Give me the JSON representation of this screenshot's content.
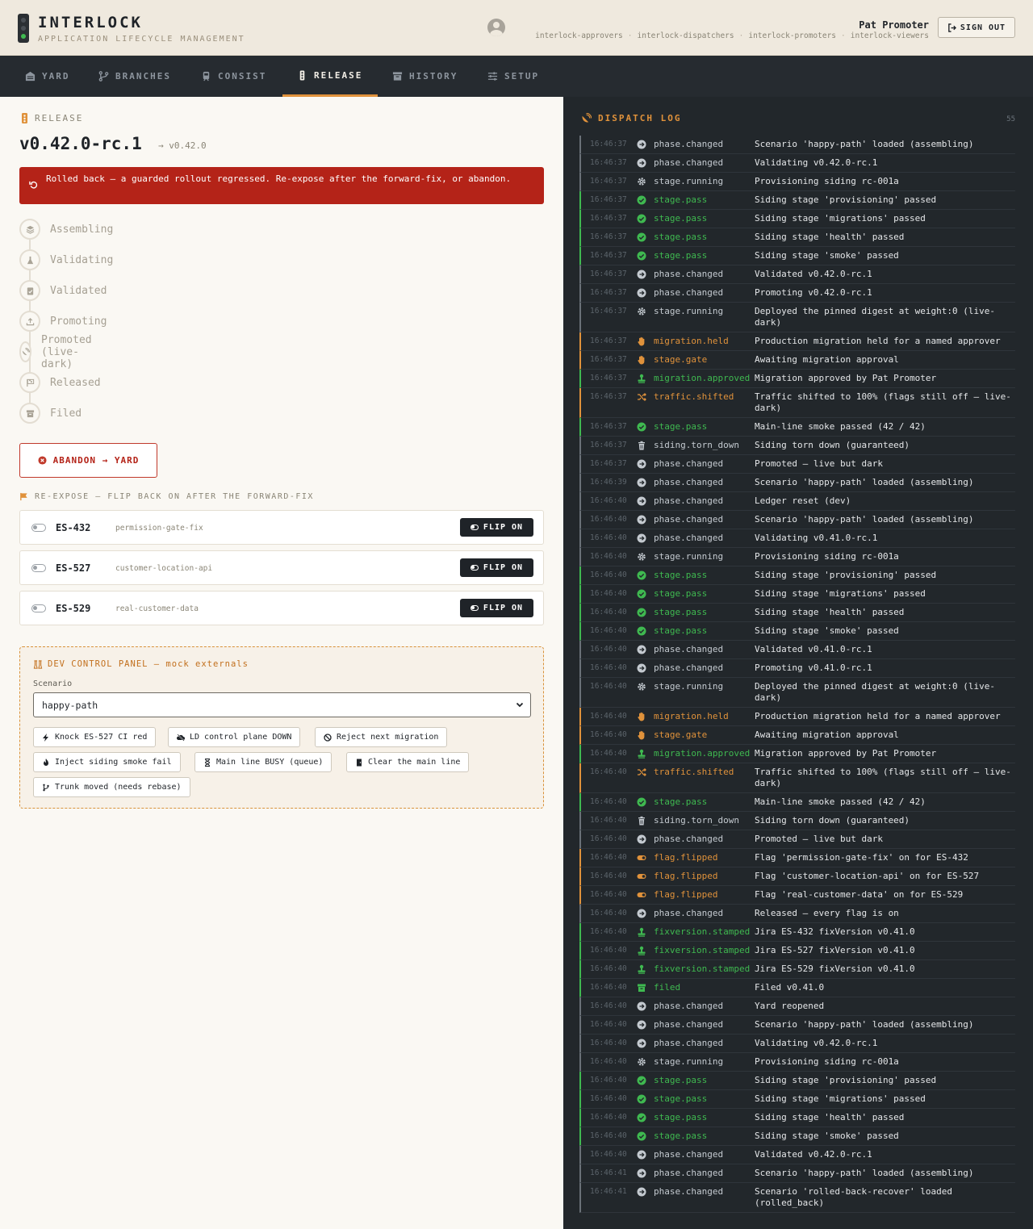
{
  "header": {
    "brand": "INTERLOCK",
    "tagline": "APPLICATION LIFECYCLE MANAGEMENT",
    "user_name": "Pat Promoter",
    "groups": [
      "interlock-approvers",
      "interlock-dispatchers",
      "interlock-promoters",
      "interlock-viewers"
    ],
    "sign_out": "SIGN OUT"
  },
  "nav": {
    "tabs": [
      {
        "label": "YARD",
        "icon": "warehouse-icon"
      },
      {
        "label": "BRANCHES",
        "icon": "branch-icon"
      },
      {
        "label": "CONSIST",
        "icon": "train-icon"
      },
      {
        "label": "RELEASE",
        "icon": "traffic-light-icon",
        "active": true
      },
      {
        "label": "HISTORY",
        "icon": "archive-icon"
      },
      {
        "label": "SETUP",
        "icon": "sliders-icon"
      }
    ]
  },
  "release": {
    "section_label": "RELEASE",
    "version": "v0.42.0-rc.1",
    "target_version": "→ v0.42.0",
    "alert": "Rolled back — a guarded rollout regressed. Re-expose after the forward-fix, or abandon.",
    "steps": [
      {
        "label": "Assembling",
        "icon": "layers-icon"
      },
      {
        "label": "Validating",
        "icon": "flask-icon"
      },
      {
        "label": "Validated",
        "icon": "clipboard-check-icon"
      },
      {
        "label": "Promoting",
        "icon": "upload-icon"
      },
      {
        "label": "Promoted (live-dark)",
        "icon": "satellite-dish-icon"
      },
      {
        "label": "Released",
        "icon": "flag-checkered-icon"
      },
      {
        "label": "Filed",
        "icon": "archive-icon"
      }
    ],
    "abandon_label": "ABANDON → YARD",
    "reexpose_label": "RE-EXPOSE — FLIP BACK ON AFTER THE FORWARD-FIX",
    "flags": [
      {
        "key": "ES-432",
        "name": "permission-gate-fix",
        "button": "FLIP ON"
      },
      {
        "key": "ES-527",
        "name": "customer-location-api",
        "button": "FLIP ON"
      },
      {
        "key": "ES-529",
        "name": "real-customer-data",
        "button": "FLIP ON"
      }
    ]
  },
  "dev_panel": {
    "title": "DEV CONTROL PANEL — mock externals",
    "scenario_label": "Scenario",
    "scenario_value": "happy-path",
    "buttons": [
      {
        "label": "Knock ES-527 CI red",
        "icon": "bolt-icon"
      },
      {
        "label": "LD control plane DOWN",
        "icon": "cloud-off-icon"
      },
      {
        "label": "Reject next migration",
        "icon": "ban-icon"
      },
      {
        "label": "Inject siding smoke fail",
        "icon": "fire-icon"
      },
      {
        "label": "Main line BUSY (queue)",
        "icon": "hourglass-icon"
      },
      {
        "label": "Clear the main line",
        "icon": "door-icon"
      },
      {
        "label": "Trunk moved (needs rebase)",
        "icon": "branch-icon"
      }
    ]
  },
  "dispatch_log": {
    "title": "DISPATCH LOG",
    "count": "55",
    "colors": {
      "pass": "#3fb950",
      "warn": "#e0923b",
      "neutral": "#c4cad0"
    },
    "entries": [
      {
        "t": "16:46:37",
        "icon": "arrow-circle",
        "kind": "neutral",
        "event": "phase.changed",
        "msg": "Scenario 'happy-path' loaded (assembling)"
      },
      {
        "t": "16:46:37",
        "icon": "arrow-circle",
        "kind": "neutral",
        "event": "phase.changed",
        "msg": "Validating v0.42.0-rc.1"
      },
      {
        "t": "16:46:37",
        "icon": "gear",
        "kind": "neutral",
        "event": "stage.running",
        "msg": "Provisioning siding rc-001a"
      },
      {
        "t": "16:46:37",
        "icon": "check-circle",
        "kind": "green",
        "event": "stage.pass",
        "msg": "Siding stage 'provisioning' passed"
      },
      {
        "t": "16:46:37",
        "icon": "check-circle",
        "kind": "green",
        "event": "stage.pass",
        "msg": "Siding stage 'migrations' passed"
      },
      {
        "t": "16:46:37",
        "icon": "check-circle",
        "kind": "green",
        "event": "stage.pass",
        "msg": "Siding stage 'health' passed"
      },
      {
        "t": "16:46:37",
        "icon": "check-circle",
        "kind": "green",
        "event": "stage.pass",
        "msg": "Siding stage 'smoke' passed"
      },
      {
        "t": "16:46:37",
        "icon": "arrow-circle",
        "kind": "neutral",
        "event": "phase.changed",
        "msg": "Validated v0.42.0-rc.1"
      },
      {
        "t": "16:46:37",
        "icon": "arrow-circle",
        "kind": "neutral",
        "event": "phase.changed",
        "msg": "Promoting v0.42.0-rc.1"
      },
      {
        "t": "16:46:37",
        "icon": "gear",
        "kind": "neutral",
        "event": "stage.running",
        "msg": "Deployed the pinned digest at weight:0 (live-dark)",
        "tall": true
      },
      {
        "t": "16:46:37",
        "icon": "hand",
        "kind": "amber",
        "event": "migration.held",
        "msg": "Production migration held for a named approver"
      },
      {
        "t": "16:46:37",
        "icon": "hand",
        "kind": "amber",
        "event": "stage.gate",
        "msg": "Awaiting migration approval"
      },
      {
        "t": "16:46:37",
        "icon": "stamp",
        "kind": "green",
        "event": "migration.approved",
        "msg": "Migration approved by Pat Promoter"
      },
      {
        "t": "16:46:37",
        "icon": "shuffle",
        "kind": "amber",
        "event": "traffic.shifted",
        "msg": "Traffic shifted to 100% (flags still off — live-dark)",
        "tall": true
      },
      {
        "t": "16:46:37",
        "icon": "check-circle",
        "kind": "green",
        "event": "stage.pass",
        "msg": "Main-line smoke passed (42 / 42)"
      },
      {
        "t": "16:46:37",
        "icon": "trash",
        "kind": "neutral",
        "event": "siding.torn_down",
        "msg": "Siding torn down (guaranteed)"
      },
      {
        "t": "16:46:37",
        "icon": "arrow-circle",
        "kind": "neutral",
        "event": "phase.changed",
        "msg": "Promoted — live but dark"
      },
      {
        "t": "16:46:39",
        "icon": "arrow-circle",
        "kind": "neutral",
        "event": "phase.changed",
        "msg": "Scenario 'happy-path' loaded (assembling)"
      },
      {
        "t": "16:46:40",
        "icon": "arrow-circle",
        "kind": "neutral",
        "event": "phase.changed",
        "msg": "Ledger reset (dev)"
      },
      {
        "t": "16:46:40",
        "icon": "arrow-circle",
        "kind": "neutral",
        "event": "phase.changed",
        "msg": "Scenario 'happy-path' loaded (assembling)"
      },
      {
        "t": "16:46:40",
        "icon": "arrow-circle",
        "kind": "neutral",
        "event": "phase.changed",
        "msg": "Validating v0.41.0-rc.1"
      },
      {
        "t": "16:46:40",
        "icon": "gear",
        "kind": "neutral",
        "event": "stage.running",
        "msg": "Provisioning siding rc-001a"
      },
      {
        "t": "16:46:40",
        "icon": "check-circle",
        "kind": "green",
        "event": "stage.pass",
        "msg": "Siding stage 'provisioning' passed"
      },
      {
        "t": "16:46:40",
        "icon": "check-circle",
        "kind": "green",
        "event": "stage.pass",
        "msg": "Siding stage 'migrations' passed"
      },
      {
        "t": "16:46:40",
        "icon": "check-circle",
        "kind": "green",
        "event": "stage.pass",
        "msg": "Siding stage 'health' passed"
      },
      {
        "t": "16:46:40",
        "icon": "check-circle",
        "kind": "green",
        "event": "stage.pass",
        "msg": "Siding stage 'smoke' passed"
      },
      {
        "t": "16:46:40",
        "icon": "arrow-circle",
        "kind": "neutral",
        "event": "phase.changed",
        "msg": "Validated v0.41.0-rc.1"
      },
      {
        "t": "16:46:40",
        "icon": "arrow-circle",
        "kind": "neutral",
        "event": "phase.changed",
        "msg": "Promoting v0.41.0-rc.1"
      },
      {
        "t": "16:46:40",
        "icon": "gear",
        "kind": "neutral",
        "event": "stage.running",
        "msg": "Deployed the pinned digest at weight:0 (live-dark)",
        "tall": true
      },
      {
        "t": "16:46:40",
        "icon": "hand",
        "kind": "amber",
        "event": "migration.held",
        "msg": "Production migration held for a named approver"
      },
      {
        "t": "16:46:40",
        "icon": "hand",
        "kind": "amber",
        "event": "stage.gate",
        "msg": "Awaiting migration approval"
      },
      {
        "t": "16:46:40",
        "icon": "stamp",
        "kind": "green",
        "event": "migration.approved",
        "msg": "Migration approved by Pat Promoter"
      },
      {
        "t": "16:46:40",
        "icon": "shuffle",
        "kind": "amber",
        "event": "traffic.shifted",
        "msg": "Traffic shifted to 100% (flags still off — live-dark)",
        "tall": true
      },
      {
        "t": "16:46:40",
        "icon": "check-circle",
        "kind": "green",
        "event": "stage.pass",
        "msg": "Main-line smoke passed (42 / 42)"
      },
      {
        "t": "16:46:40",
        "icon": "trash",
        "kind": "neutral",
        "event": "siding.torn_down",
        "msg": "Siding torn down (guaranteed)"
      },
      {
        "t": "16:46:40",
        "icon": "arrow-circle",
        "kind": "neutral",
        "event": "phase.changed",
        "msg": "Promoted — live but dark"
      },
      {
        "t": "16:46:40",
        "icon": "toggle",
        "kind": "amber",
        "event": "flag.flipped",
        "msg": "Flag 'permission-gate-fix' on for ES-432"
      },
      {
        "t": "16:46:40",
        "icon": "toggle",
        "kind": "amber",
        "event": "flag.flipped",
        "msg": "Flag 'customer-location-api' on for ES-527"
      },
      {
        "t": "16:46:40",
        "icon": "toggle",
        "kind": "amber",
        "event": "flag.flipped",
        "msg": "Flag 'real-customer-data' on for ES-529"
      },
      {
        "t": "16:46:40",
        "icon": "arrow-circle",
        "kind": "neutral",
        "event": "phase.changed",
        "msg": "Released — every flag is on"
      },
      {
        "t": "16:46:40",
        "icon": "stamp",
        "kind": "green",
        "event": "fixversion.stamped",
        "msg": "Jira ES-432 fixVersion v0.41.0"
      },
      {
        "t": "16:46:40",
        "icon": "stamp",
        "kind": "green",
        "event": "fixversion.stamped",
        "msg": "Jira ES-527 fixVersion v0.41.0"
      },
      {
        "t": "16:46:40",
        "icon": "stamp",
        "kind": "green",
        "event": "fixversion.stamped",
        "msg": "Jira ES-529 fixVersion v0.41.0"
      },
      {
        "t": "16:46:40",
        "icon": "archive",
        "kind": "green",
        "event": "filed",
        "msg": "Filed v0.41.0"
      },
      {
        "t": "16:46:40",
        "icon": "arrow-circle",
        "kind": "neutral",
        "event": "phase.changed",
        "msg": "Yard reopened"
      },
      {
        "t": "16:46:40",
        "icon": "arrow-circle",
        "kind": "neutral",
        "event": "phase.changed",
        "msg": "Scenario 'happy-path' loaded (assembling)"
      },
      {
        "t": "16:46:40",
        "icon": "arrow-circle",
        "kind": "neutral",
        "event": "phase.changed",
        "msg": "Validating v0.42.0-rc.1"
      },
      {
        "t": "16:46:40",
        "icon": "gear",
        "kind": "neutral",
        "event": "stage.running",
        "msg": "Provisioning siding rc-001a"
      },
      {
        "t": "16:46:40",
        "icon": "check-circle",
        "kind": "green",
        "event": "stage.pass",
        "msg": "Siding stage 'provisioning' passed"
      },
      {
        "t": "16:46:40",
        "icon": "check-circle",
        "kind": "green",
        "event": "stage.pass",
        "msg": "Siding stage 'migrations' passed"
      },
      {
        "t": "16:46:40",
        "icon": "check-circle",
        "kind": "green",
        "event": "stage.pass",
        "msg": "Siding stage 'health' passed"
      },
      {
        "t": "16:46:40",
        "icon": "check-circle",
        "kind": "green",
        "event": "stage.pass",
        "msg": "Siding stage 'smoke' passed"
      },
      {
        "t": "16:46:40",
        "icon": "arrow-circle",
        "kind": "neutral",
        "event": "phase.changed",
        "msg": "Validated v0.42.0-rc.1"
      },
      {
        "t": "16:46:41",
        "icon": "arrow-circle",
        "kind": "neutral",
        "event": "phase.changed",
        "msg": "Scenario 'happy-path' loaded (assembling)"
      },
      {
        "t": "16:46:41",
        "icon": "arrow-circle",
        "kind": "neutral",
        "event": "phase.changed",
        "msg": "Scenario 'rolled-back-recover' loaded (rolled_back)",
        "tall": true
      }
    ]
  }
}
